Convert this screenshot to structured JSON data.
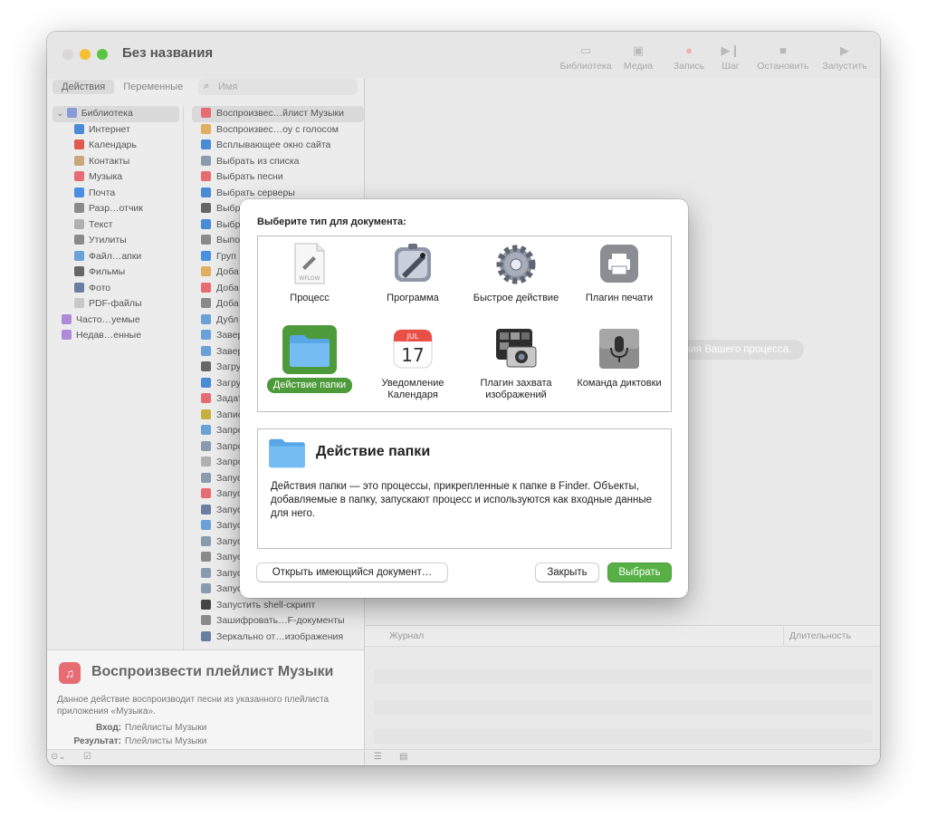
{
  "window": {
    "title": "Без названия"
  },
  "toolbar": {
    "library": "Библиотека",
    "media": "Медиа",
    "record": "Запись",
    "step": "Шаг",
    "stop": "Остановить",
    "run": "Запустить"
  },
  "left": {
    "tabs": {
      "actions": "Действия",
      "variables": "Переменные"
    },
    "search_placeholder": "Имя",
    "tree": [
      {
        "label": "Библиотека",
        "color": "#8a9bd8"
      },
      {
        "label": "Интернет",
        "color": "#4a8bd6"
      },
      {
        "label": "Календарь",
        "color": "#e05a4e"
      },
      {
        "label": "Контакты",
        "color": "#c9a77a"
      },
      {
        "label": "Музыка",
        "color": "#e76b73"
      },
      {
        "label": "Почта",
        "color": "#4a90e2"
      },
      {
        "label": "Разр…отчик",
        "color": "#8a8a8a"
      },
      {
        "label": "Текст",
        "color": "#b0b0b0"
      },
      {
        "label": "Утилиты",
        "color": "#8a8a8a"
      },
      {
        "label": "Файл…апки",
        "color": "#6aa1d8"
      },
      {
        "label": "Фильмы",
        "color": "#666666"
      },
      {
        "label": "Фото",
        "color": "#6a7fa0"
      },
      {
        "label": "PDF-файлы",
        "color": "#c8c8c8"
      },
      {
        "label": "Часто…уемые",
        "color": "#b08ad8"
      },
      {
        "label": "Недав…енные",
        "color": "#b08ad8"
      }
    ],
    "actions": [
      {
        "label": "Воспроизвес…йлист Музыки",
        "color": "#e76b73"
      },
      {
        "label": "Воспроизвес…оу с голосом",
        "color": "#e0b060"
      },
      {
        "label": "Всплывающее окно сайта",
        "color": "#4a8bd6"
      },
      {
        "label": "Выбрать из списка",
        "color": "#8a9bb0"
      },
      {
        "label": "Выбрать песни",
        "color": "#e76b73"
      },
      {
        "label": "Выбрать серверы",
        "color": "#4a8bd6"
      },
      {
        "label": "Выбр",
        "color": "#666666"
      },
      {
        "label": "Выбр",
        "color": "#4a8bd6"
      },
      {
        "label": "Выпо",
        "color": "#8a8a8a"
      },
      {
        "label": "Груп",
        "color": "#4a90e2"
      },
      {
        "label": "Доба",
        "color": "#e0b060"
      },
      {
        "label": "Доба",
        "color": "#e76b73"
      },
      {
        "label": "Доба",
        "color": "#8a8a8a"
      },
      {
        "label": "Дубл",
        "color": "#6aa1d8"
      },
      {
        "label": "Завер",
        "color": "#6aa1d8"
      },
      {
        "label": "Завер",
        "color": "#6aa1d8"
      },
      {
        "label": "Загру",
        "color": "#666666"
      },
      {
        "label": "Загру",
        "color": "#4a8bd6"
      },
      {
        "label": "Задат",
        "color": "#e76b73"
      },
      {
        "label": "Запис",
        "color": "#c8b040"
      },
      {
        "label": "Запро",
        "color": "#6aa1d8"
      },
      {
        "label": "Запро",
        "color": "#8a9bb0"
      },
      {
        "label": "Запро",
        "color": "#b0b0b0"
      },
      {
        "label": "Запус",
        "color": "#8a9bb0"
      },
      {
        "label": "Запус",
        "color": "#e76b73"
      },
      {
        "label": "Запус",
        "color": "#6a7fa0"
      },
      {
        "label": "Запус",
        "color": "#6aa1d8"
      },
      {
        "label": "Запус",
        "color": "#8a9bb0"
      },
      {
        "label": "Запус",
        "color": "#8a8a8a"
      },
      {
        "label": "Запус",
        "color": "#8a9bb0"
      },
      {
        "label": "Запус",
        "color": "#8a9bb0"
      },
      {
        "label": "Запустить shell-скрипт",
        "color": "#444444"
      },
      {
        "label": "Зашифровать…F-документы",
        "color": "#8a8a8a"
      },
      {
        "label": "Зеркально от…изображения",
        "color": "#6a7fa0"
      }
    ],
    "description": {
      "title": "Воспроизвести плейлист Музыки",
      "text": "Данное действие воспроизводит песни из указанного плейлиста приложения «Музыка».",
      "input_label": "Вход:",
      "input_value": "Плейлисты Музыки",
      "result_label": "Результат:",
      "result_value": "Плейлисты Музыки"
    }
  },
  "right": {
    "hint": "ния Вашего процесса.",
    "log_col": "Журнал",
    "duration_col": "Длительность"
  },
  "dialog": {
    "title": "Выберите тип для документа:",
    "types": [
      {
        "name": "Процесс",
        "icon": "workflow-icon"
      },
      {
        "name": "Программа",
        "icon": "application-icon"
      },
      {
        "name": "Быстрое действие",
        "icon": "gear-icon"
      },
      {
        "name": "Плагин печати",
        "icon": "printer-icon"
      },
      {
        "name": "Действие папки",
        "icon": "folder-icon"
      },
      {
        "name": "Уведомление Календаря",
        "icon": "calendar-icon"
      },
      {
        "name": "Плагин захвата изображений",
        "icon": "camera-icon"
      },
      {
        "name": "Команда диктовки",
        "icon": "microphone-icon"
      }
    ],
    "selected": "Действие папки",
    "workflow_file_label": "WFLOW",
    "calendar_month": "JUL",
    "calendar_day": "17",
    "info_title": "Действие папки",
    "info_text": "Действия папки — это процессы, прикрепленные к папке в Finder. Объекты, добавляемые в папку, запускают процесс и используются как входные данные для него.",
    "open_button": "Открыть имеющийся документ…",
    "close_button": "Закрыть",
    "choose_button": "Выбрать",
    "accent": "#57b046"
  }
}
